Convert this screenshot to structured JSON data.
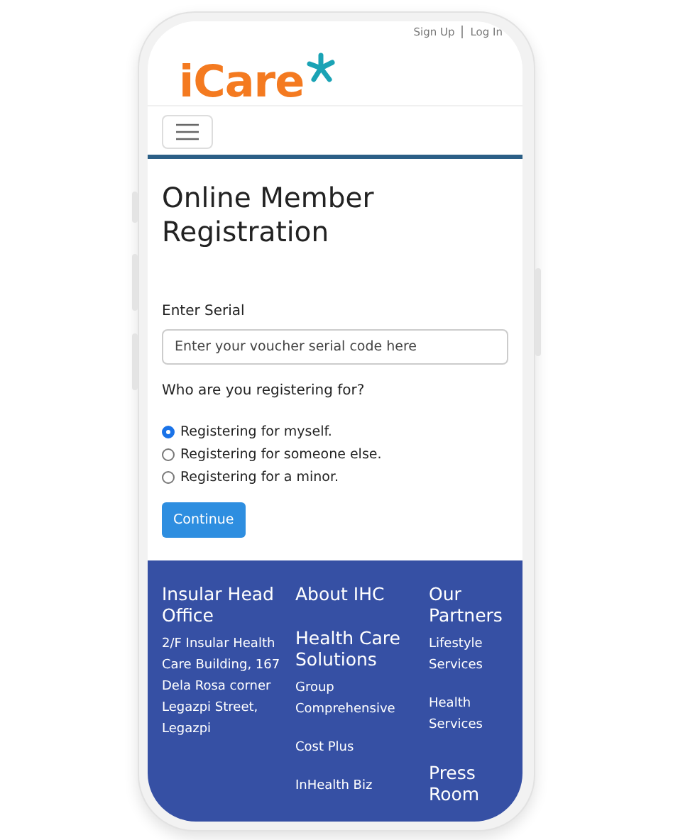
{
  "top_links": [
    {
      "label": "Sign Up"
    },
    {
      "label": "Log In"
    }
  ],
  "logo": "iCare",
  "title": "Online Member Registration",
  "serial": {
    "label": "Enter Serial",
    "placeholder": "Enter your voucher serial code here"
  },
  "question": "Who are you registering for?",
  "options": [
    {
      "label": "Registering for myself.",
      "selected": true
    },
    {
      "label": "Registering for someone else.",
      "selected": false
    },
    {
      "label": "Registering for a minor.",
      "selected": false
    }
  ],
  "continue_button": "Continue",
  "footer": {
    "columns": [
      {
        "blocks": [
          {
            "kind": "heading",
            "text": "Insular Head Office"
          },
          {
            "kind": "text",
            "text": "2/F Insular Health Care Building, 167 Dela Rosa corner Legazpi Street, Legazpi"
          }
        ]
      },
      {
        "blocks": [
          {
            "kind": "heading",
            "text": "About IHC"
          },
          {
            "kind": "heading",
            "text": "Health Care Solutions"
          },
          {
            "kind": "link",
            "text": "Group Comprehensive"
          },
          {
            "kind": "link",
            "text": "Cost Plus"
          },
          {
            "kind": "link",
            "text": "InHealth Biz"
          }
        ]
      },
      {
        "blocks": [
          {
            "kind": "heading",
            "text": "Our Partners"
          },
          {
            "kind": "link",
            "text": "Lifestyle Services"
          },
          {
            "kind": "link",
            "text": "Health Services"
          },
          {
            "kind": "heading",
            "text": "Press Room"
          }
        ]
      }
    ]
  }
}
